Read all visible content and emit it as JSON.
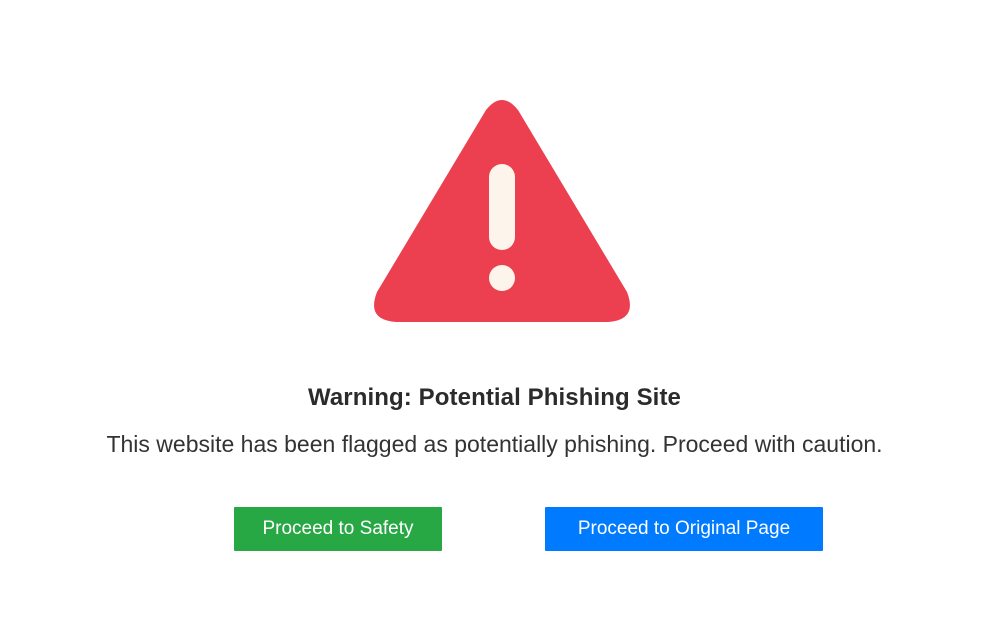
{
  "warning": {
    "icon": "warning-triangle-icon",
    "icon_color": "#ec3f4f",
    "exclamation_color": "#fdf5ec",
    "title": "Warning: Potential Phishing Site",
    "message": "This website has been flagged as potentially phishing. Proceed with caution."
  },
  "actions": {
    "safety_label": "Proceed to Safety",
    "safety_color": "#28a745",
    "original_label": "Proceed to Original Page",
    "original_color": "#007bff"
  }
}
